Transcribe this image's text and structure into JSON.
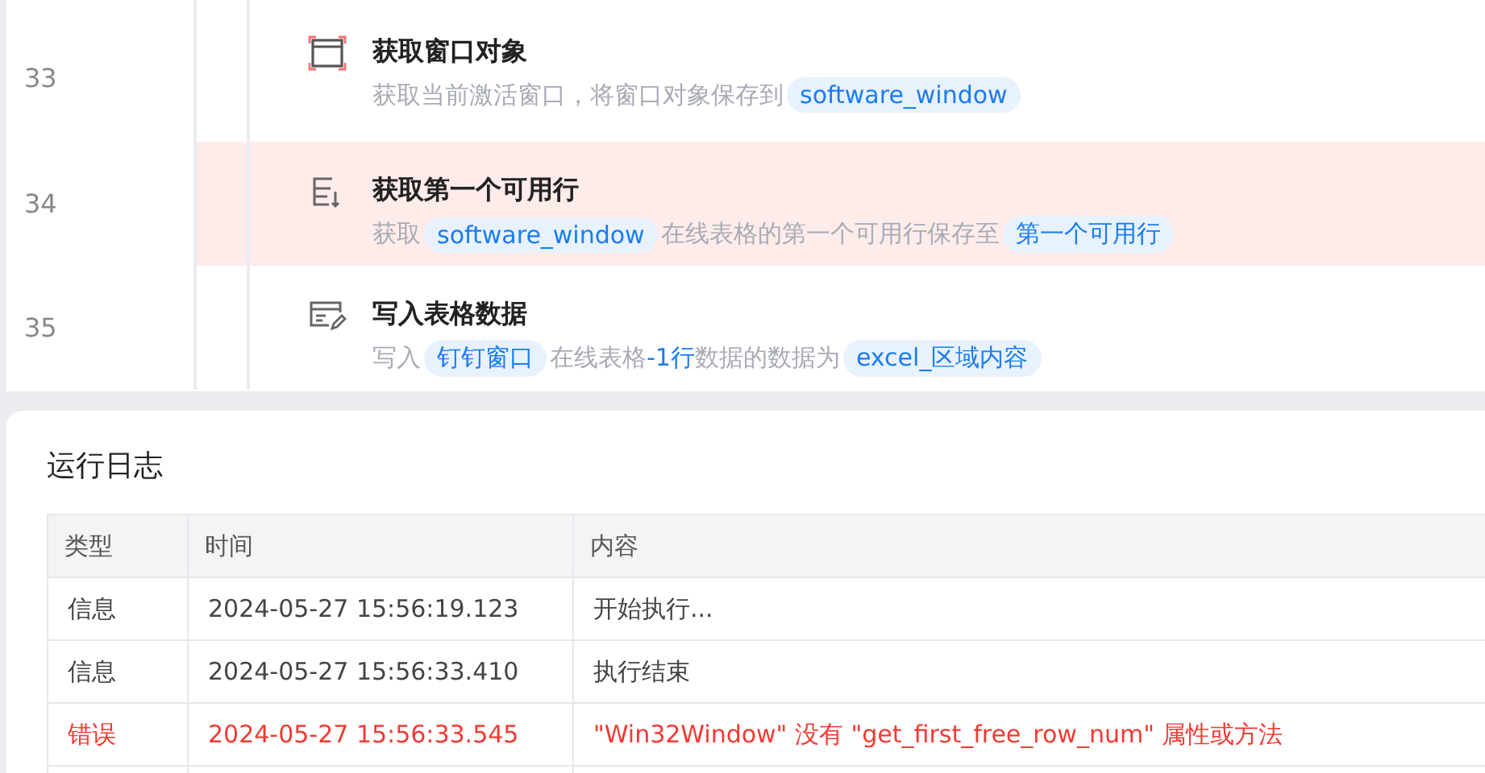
{
  "steps": [
    {
      "line": "33",
      "kind": "window",
      "error": false,
      "title": "获取窗口对象",
      "description": [
        {
          "kind": "text",
          "text": "获取当前激活窗口，将窗口对象保存到"
        },
        {
          "kind": "var",
          "text": "software_window"
        }
      ]
    },
    {
      "line": "34",
      "kind": "table-row",
      "error": true,
      "title": "获取第一个可用行",
      "description": [
        {
          "kind": "text",
          "text": "获取"
        },
        {
          "kind": "var",
          "text": "software_window"
        },
        {
          "kind": "text",
          "text": "在线表格的第一个可用行保存至"
        },
        {
          "kind": "var",
          "text": "第一个可用行"
        }
      ]
    },
    {
      "line": "35",
      "kind": "table-edit",
      "error": false,
      "title": "写入表格数据",
      "description": [
        {
          "kind": "text",
          "text": "写入"
        },
        {
          "kind": "var",
          "text": "钉钉窗口"
        },
        {
          "kind": "text",
          "text": "在线表格"
        },
        {
          "kind": "link",
          "text": "-1行"
        },
        {
          "kind": "text",
          "text": "数据的数据为"
        },
        {
          "kind": "var",
          "text": "excel_区域内容"
        }
      ]
    }
  ],
  "log": {
    "title": "运行日志",
    "columns": [
      "类型",
      "时间",
      "内容"
    ],
    "rows": [
      {
        "kind": "info",
        "type": "信息",
        "time": "2024-05-27 15:56:19.123",
        "content": "开始执行..."
      },
      {
        "kind": "info",
        "type": "信息",
        "time": "2024-05-27 15:56:33.410",
        "content": "执行结束"
      },
      {
        "kind": "error",
        "type": "错误",
        "time": "2024-05-27 15:56:33.545",
        "content": "\"Win32Window\" 没有 \"get_first_free_row_num\" 属性或方法"
      }
    ]
  }
}
